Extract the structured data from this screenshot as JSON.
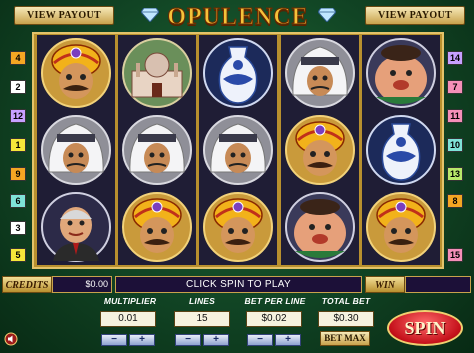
{
  "header": {
    "title": "OPULENCE",
    "view_payout_left": "VIEW PAYOUT",
    "view_payout_right": "VIEW PAYOUT"
  },
  "paylines_left": [
    "4",
    "2",
    "12",
    "1",
    "9",
    "6",
    "3",
    "5"
  ],
  "paylines_right": [
    "14",
    "7",
    "11",
    "10",
    "13",
    "8",
    "15"
  ],
  "reels": [
    [
      "maharaja-symbol",
      "turban-sheikh-symbol",
      "businessman-symbol"
    ],
    [
      "palace-symbol",
      "turban-sheikh-symbol",
      "maharaja-symbol"
    ],
    [
      "vase-symbol",
      "turban-sheikh-symbol",
      "maharaja-symbol"
    ],
    [
      "turban-sheikh-symbol",
      "maharaja-symbol",
      "fat-man-symbol"
    ],
    [
      "fat-man-symbol",
      "vase-symbol",
      "maharaja-symbol"
    ]
  ],
  "status": {
    "credits_label": "CREDITS",
    "credits_value": "$0.00",
    "message": "CLICK SPIN TO PLAY",
    "win_label": "WIN",
    "win_value": ""
  },
  "controls": {
    "multiplier_label": "MULTIPLIER",
    "multiplier_value": "0.01",
    "lines_label": "LINES",
    "lines_value": "15",
    "bet_per_line_label": "BET PER LINE",
    "bet_per_line_value": "$0.02",
    "total_bet_label": "TOTAL BET",
    "total_bet_value": "$0.30",
    "minus": "−",
    "plus": "+",
    "bet_max_label": "BET MAX",
    "spin_label": "SPIN"
  },
  "colors": {
    "felt": "#1f6a34",
    "gold": "#c8a24c",
    "reel_bg": "#1f1d35",
    "spin_red": "#c4101a"
  }
}
